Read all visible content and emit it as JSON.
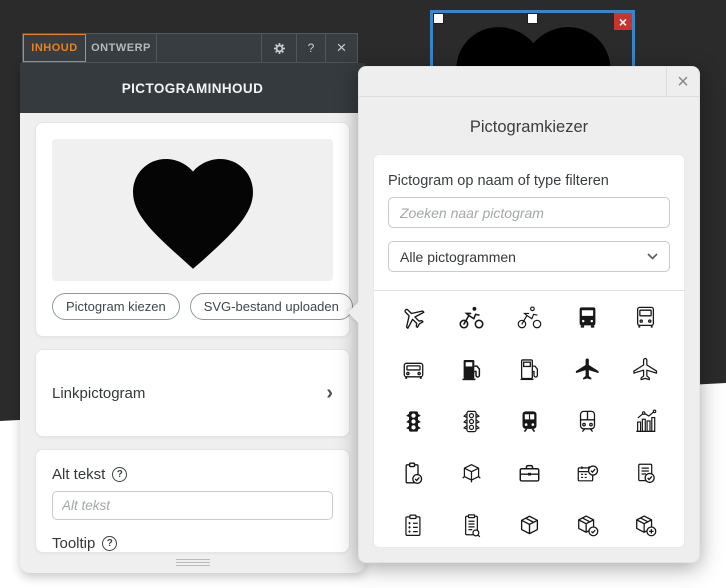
{
  "toolbar": {
    "tabs": [
      {
        "label": "INHOUD",
        "active": true
      },
      {
        "label": "ONTWERP",
        "active": false
      }
    ],
    "help_label": "?",
    "close_label": "×"
  },
  "canvas": {
    "selected_icon": "heart",
    "delete_label": "×"
  },
  "panel": {
    "title": "PICTOGRAMINHOUD",
    "preview_icon": "heart",
    "choose_button": "Pictogram kiezen",
    "upload_button": "SVG-bestand uploaden",
    "link_section": "Linkpictogram",
    "alt_label": "Alt tekst",
    "alt_placeholder": "Alt tekst",
    "tooltip_label": "Tooltip",
    "help_glyph": "?"
  },
  "picker": {
    "title": "Pictogramkiezer",
    "close_label": "×",
    "filter_label": "Pictogram op naam of type filteren",
    "search_placeholder": "Zoeken naar pictogram",
    "category_value": "Alle pictogrammen",
    "icon_rows": [
      [
        "airplane-tilted-outline",
        "cyclist",
        "cyclist-outline",
        "bus-front-filled",
        "bus-front-outline"
      ],
      [
        "van-front-outline",
        "fuel-pump-filled",
        "fuel-pump-outline",
        "airplane-filled",
        "airplane-outline"
      ],
      [
        "traffic-light-filled",
        "traffic-light-outline",
        "train-front-filled",
        "train-front-outline",
        "bar-line-chart"
      ],
      [
        "clipboard-check",
        "cube-3d",
        "briefcase",
        "calendar-check",
        "note-check"
      ],
      [
        "clipboard-list",
        "document-search",
        "package-box",
        "package-check",
        "package-plus"
      ]
    ]
  },
  "colors": {
    "accent_orange": "#e8831d",
    "selection_blue": "#3a85c8",
    "delete_red": "#c9352c",
    "header_dark": "#343a3d",
    "canvas_dark": "#2b2b2b",
    "panel_bg": "#f0efef"
  }
}
